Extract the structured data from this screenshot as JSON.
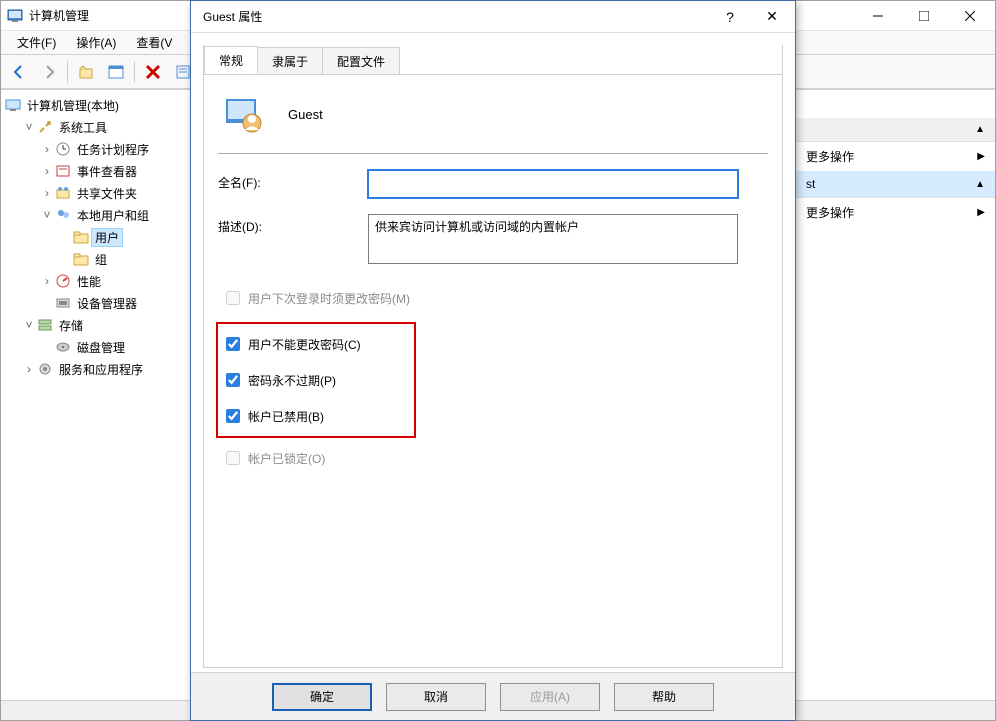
{
  "app": {
    "title": "计算机管理",
    "menu": {
      "file": "文件(F)",
      "action": "操作(A)",
      "view": "查看(V"
    }
  },
  "tree": {
    "root": "计算机管理(本地)",
    "sys_tools": "系统工具",
    "task": "任务计划程序",
    "event": "事件查看器",
    "share": "共享文件夹",
    "local_ug": "本地用户和组",
    "users": "用户",
    "groups": "组",
    "perf": "性能",
    "devmgr": "设备管理器",
    "storage": "存储",
    "diskmgr": "磁盘管理",
    "services": "服务和应用程序"
  },
  "actions": {
    "more1": "更多操作",
    "selected": "st",
    "more2": "更多操作"
  },
  "dialog": {
    "title": "Guest 属性",
    "tabs": {
      "general": "常规",
      "member": "隶属于",
      "profile": "配置文件"
    },
    "username": "Guest",
    "fullname_label": "全名(F):",
    "fullname_value": "",
    "desc_label": "描述(D):",
    "desc_value": "供来宾访问计算机或访问域的内置帐户",
    "cb_must_change": "用户下次登录时须更改密码(M)",
    "cb_cannot_change": "用户不能更改密码(C)",
    "cb_never_expire": "密码永不过期(P)",
    "cb_disabled": "帐户已禁用(B)",
    "cb_locked": "帐户已锁定(O)",
    "btn_ok": "确定",
    "btn_cancel": "取消",
    "btn_apply": "应用(A)",
    "btn_help": "帮助"
  }
}
